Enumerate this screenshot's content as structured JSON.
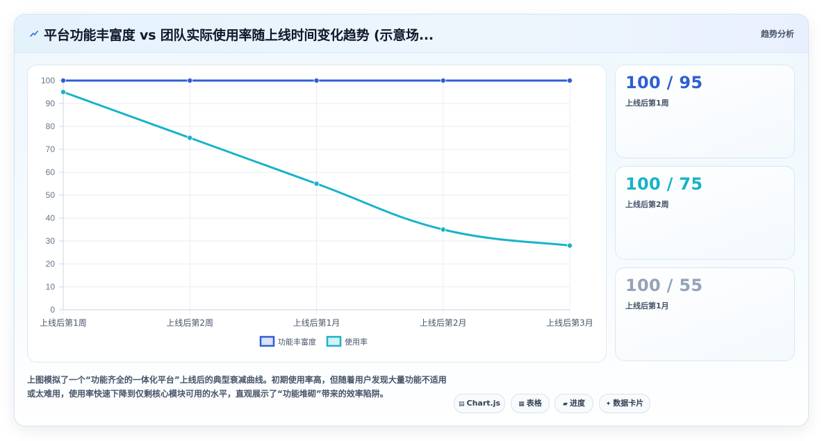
{
  "header": {
    "title": "平台功能丰富度 vs 团队实际使用率随上线时间变化趋势 (示意场...",
    "tag": "趋势分析",
    "icon": "trend-line-icon"
  },
  "chart_data": {
    "type": "line",
    "categories": [
      "上线后第1周",
      "上线后第2周",
      "上线后第1月",
      "上线后第2月",
      "上线后第3月"
    ],
    "series": [
      {
        "name": "功能丰富度",
        "values": [
          100,
          100,
          100,
          100,
          100
        ],
        "color": "#2f5fd6"
      },
      {
        "name": "使用率",
        "values": [
          95,
          75,
          55,
          35,
          28
        ],
        "color": "#17b3c9"
      }
    ],
    "ylim": [
      0,
      100
    ],
    "yticks": [
      0,
      10,
      20,
      30,
      40,
      50,
      60,
      70,
      80,
      90,
      100
    ],
    "grid": true,
    "legend": "bottom"
  },
  "stats": [
    {
      "value": "100 / 95",
      "label": "上线后第1周",
      "color": "#2f5fd6"
    },
    {
      "value": "100 / 75",
      "label": "上线后第2周",
      "color": "#17b3c9"
    },
    {
      "value": "100 / 55",
      "label": "上线后第1月",
      "color": "#94a3b8"
    }
  ],
  "description": "上图模拟了一个“功能齐全的一体化平台”上线后的典型衰减曲线。初期使用率高，但随着用户发现大量功能不适用或太难用，使用率快速下降到仅剩核心模块可用的水平，直观展示了“功能堆砌”带来的效率陷阱。",
  "tags": [
    {
      "label": "Chart.js",
      "icon": "chart-icon"
    },
    {
      "label": "表格",
      "icon": "table-icon"
    },
    {
      "label": "进度",
      "icon": "progress-icon"
    },
    {
      "label": "数据卡片",
      "icon": "sparkle-icon"
    }
  ]
}
